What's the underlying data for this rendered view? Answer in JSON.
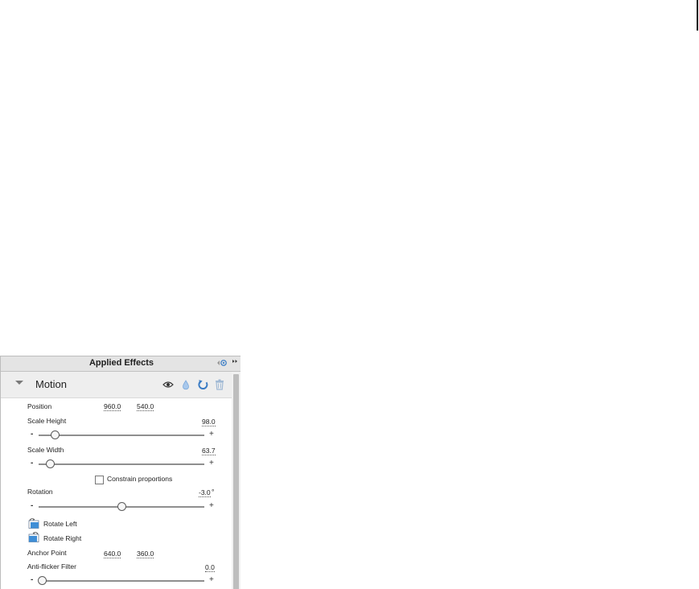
{
  "panel": {
    "title": "Applied Effects"
  },
  "effect": {
    "name": "Motion",
    "icons": [
      "eye-icon",
      "drop-icon",
      "reset-icon",
      "trash-icon"
    ]
  },
  "properties": {
    "position": {
      "label": "Position",
      "x": "960.0",
      "y": "540.0"
    },
    "scale_height": {
      "label": "Scale Height",
      "value": "98.0",
      "slider_fraction": 0.1,
      "minus": "-",
      "plus": "+"
    },
    "scale_width": {
      "label": "Scale Width",
      "value": "63.7",
      "slider_fraction": 0.07,
      "minus": "-",
      "plus": "+"
    },
    "constrain": {
      "label": "Constrain proportions",
      "checked": false
    },
    "rotation": {
      "label": "Rotation",
      "value": "-3.0",
      "unit": "°",
      "slider_fraction": 0.5,
      "minus": "-",
      "plus": "+"
    },
    "rotate_left": {
      "label": "Rotate Left"
    },
    "rotate_right": {
      "label": "Rotate Right"
    },
    "anchor_point": {
      "label": "Anchor Point",
      "x": "640.0",
      "y": "360.0"
    },
    "anti_flicker": {
      "label": "Anti-flicker Filter",
      "value": "0.0",
      "slider_fraction": 0.02,
      "minus": "-",
      "plus": "+"
    }
  },
  "colors": {
    "accent": "#4a86c8",
    "header_bg": "#e4e4e4",
    "effect_row_bg": "#eeeeee"
  }
}
